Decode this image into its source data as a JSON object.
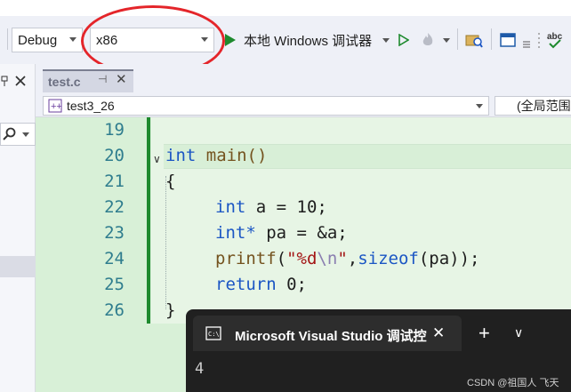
{
  "toolbar": {
    "configuration": "Debug",
    "platform": "x86",
    "run_label": "本地 Windows 调试器"
  },
  "tabs": [
    {
      "label": "test.c"
    }
  ],
  "navbar": {
    "scope": "test3_26",
    "member": "(全局范围"
  },
  "editor": {
    "lines": [
      {
        "number": "19"
      },
      {
        "number": "20"
      },
      {
        "number": "21"
      },
      {
        "number": "22"
      },
      {
        "number": "23"
      },
      {
        "number": "24"
      },
      {
        "number": "25"
      },
      {
        "number": "26"
      }
    ],
    "code": {
      "l20_type": "int",
      "l20_rest": " main()",
      "l21": "{",
      "l22_type": "int",
      "l22_rest": " a = 10;",
      "l23_type": "int*",
      "l23_rest": " pa = &a;",
      "l24_fn": "printf",
      "l24_open": "(",
      "l24_str1": "\"%d",
      "l24_esc": "\\n",
      "l24_str2": "\"",
      "l24_comma": ",",
      "l24_kw": "sizeof",
      "l24_rest": "(pa));",
      "l25_kw": "return",
      "l25_rest": " 0;",
      "l26": "}"
    }
  },
  "console": {
    "title": "Microsoft Visual Studio 调试控",
    "output": "4",
    "watermark": "CSDN @祖国人  飞天"
  },
  "colors": {
    "keyword": "#1b56c4",
    "function": "#74531f",
    "string": "#a31515",
    "annotation": "#e4252a",
    "editor_bg": "#e7f5e5"
  }
}
